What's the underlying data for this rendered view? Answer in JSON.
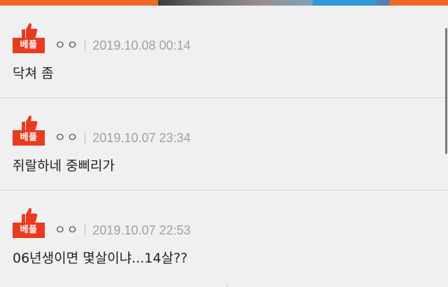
{
  "accent_color": "#ee6a24",
  "badge_color": "#ea3b1e",
  "comments": [
    {
      "badge": "베플",
      "badge_icon": "thumbs-up-icon",
      "username": "ㅇㅇ",
      "timestamp": "2019.10.08 00:14",
      "text": "닥쳐 좀"
    },
    {
      "badge": "베플",
      "badge_icon": "thumbs-up-icon",
      "username": "ㅇㅇ",
      "timestamp": "2019.10.07 23:34",
      "text": "쥐랄하네 중삐리가"
    },
    {
      "badge": "베플",
      "badge_icon": "thumbs-up-icon",
      "username": "ㅇㅇ",
      "timestamp": "2019.10.07 22:53",
      "text": "06년생이면 몇살이냐...14살??"
    }
  ]
}
